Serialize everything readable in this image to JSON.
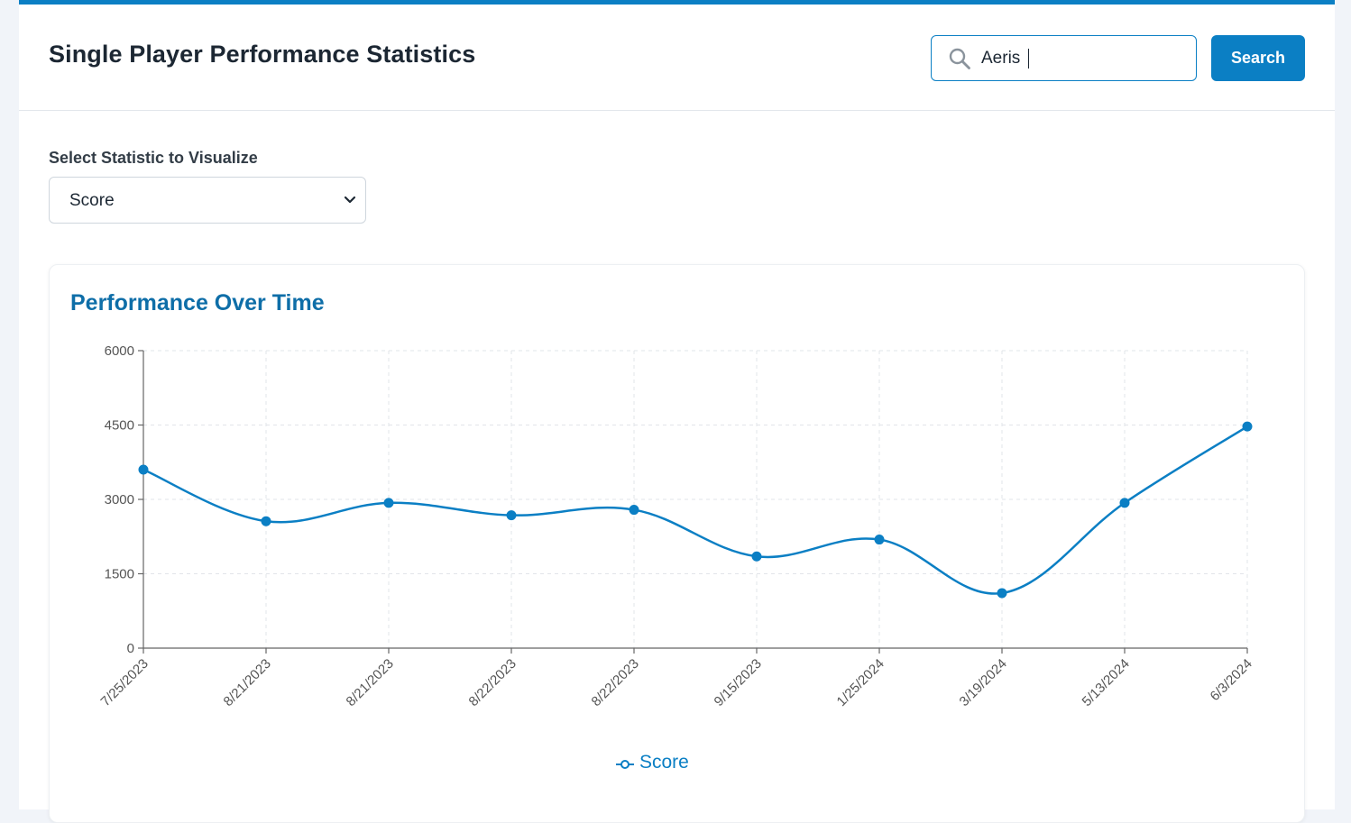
{
  "header": {
    "title": "Single Player Performance Statistics",
    "search": {
      "value": "Aeris",
      "placeholder": "",
      "button_label": "Search"
    }
  },
  "controls": {
    "stat_label": "Select Statistic to Visualize",
    "stat_selected": "Score"
  },
  "chart": {
    "title": "Performance Over Time",
    "legend_label": "Score",
    "colors": {
      "line": "#0b7fc4",
      "title": "#0e6ea8",
      "accent": "#0b7fc4"
    }
  },
  "chart_data": {
    "type": "line",
    "x": [
      "7/25/2023",
      "8/21/2023",
      "8/21/2023",
      "8/22/2023",
      "8/22/2023",
      "9/15/2023",
      "1/25/2024",
      "3/19/2024",
      "5/13/2024",
      "6/3/2024"
    ],
    "series": [
      {
        "name": "Score",
        "values": [
          3600,
          2560,
          2930,
          2680,
          2790,
          1850,
          2190,
          1110,
          2930,
          4470
        ]
      }
    ],
    "yticks": [
      0,
      1500,
      3000,
      4500,
      6000
    ],
    "ylim": [
      0,
      6000
    ],
    "grid": true,
    "curve": "smooth",
    "legend": "bottom-center",
    "title": "Performance Over Time",
    "xlabel": "",
    "ylabel": ""
  }
}
